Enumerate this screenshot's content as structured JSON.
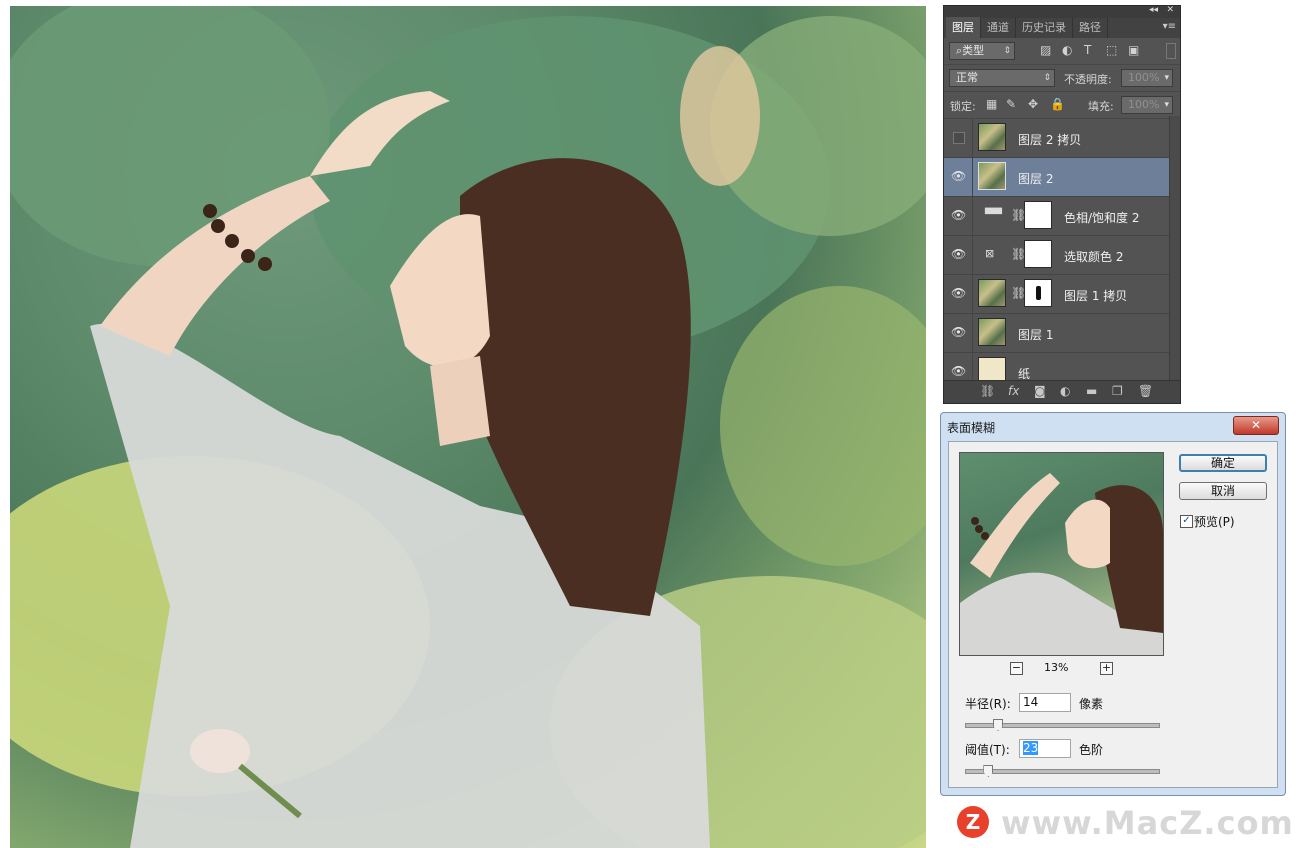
{
  "layers_panel": {
    "tabs": [
      {
        "label": "图层",
        "active": true
      },
      {
        "label": "通道",
        "active": false
      },
      {
        "label": "历史记录",
        "active": false
      },
      {
        "label": "路径",
        "active": false
      }
    ],
    "filter_kind": "类型",
    "blend_mode": "正常",
    "opacity_label": "不透明度:",
    "opacity_value": "100%",
    "lock_label": "锁定:",
    "fill_label": "填充:",
    "fill_value": "100%",
    "layers": [
      {
        "name": "图层 2 拷贝",
        "visible": false,
        "selected": false,
        "thumb": "photo",
        "adjust_icon": "",
        "has_mask": false
      },
      {
        "name": "图层 2",
        "visible": true,
        "selected": true,
        "thumb": "photo",
        "adjust_icon": "",
        "has_mask": false
      },
      {
        "name": "色相/饱和度 2",
        "visible": true,
        "selected": false,
        "thumb": "hue-saturation-icon",
        "adjust_icon": "hue",
        "has_mask": true
      },
      {
        "name": "选取颜色 2",
        "visible": true,
        "selected": false,
        "thumb": "selective-color-icon",
        "adjust_icon": "selcolor",
        "has_mask": true
      },
      {
        "name": "图层 1 拷贝",
        "visible": true,
        "selected": false,
        "thumb": "photo",
        "adjust_icon": "",
        "has_mask": true
      },
      {
        "name": "图层 1",
        "visible": true,
        "selected": false,
        "thumb": "photo",
        "adjust_icon": "",
        "has_mask": false
      },
      {
        "name": "纸",
        "visible": true,
        "selected": false,
        "thumb": "paper",
        "adjust_icon": "",
        "has_mask": false
      }
    ]
  },
  "dialog": {
    "title": "表面模糊",
    "ok_label": "确定",
    "cancel_label": "取消",
    "preview_label": "预览(P)",
    "preview_checked": true,
    "zoom": "13%",
    "radius_label": "半径(R):",
    "radius_value": "14",
    "radius_unit": "像素",
    "radius_slider_fraction": 0.14,
    "threshold_label": "阈值(T):",
    "threshold_value": "23",
    "threshold_unit": "色阶",
    "threshold_slider_fraction": 0.09
  },
  "watermark": {
    "text": "www.MacZ.com",
    "badge": "Z"
  },
  "colors": {
    "panel_bg": "#535353",
    "selected_layer": "#6d7f99",
    "dialog_frame": "#cfe0f3",
    "close_button": "#c0392b",
    "watermark_badge": "#e8402a"
  }
}
